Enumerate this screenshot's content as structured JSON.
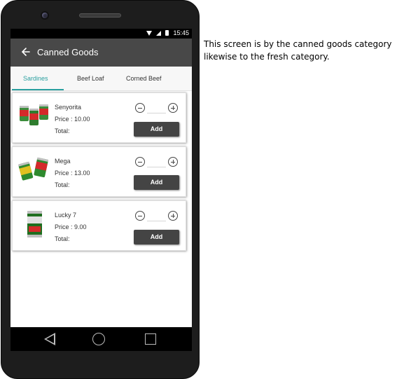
{
  "status_bar": {
    "time": "15:45"
  },
  "app_bar": {
    "title": "Canned Goods",
    "back_icon": "arrow-left-icon"
  },
  "tabs": [
    {
      "label": "Sardines",
      "active": true
    },
    {
      "label": "Beef Loaf",
      "active": false
    },
    {
      "label": "Corned Beef",
      "active": false
    }
  ],
  "products": [
    {
      "name": "Senyorita",
      "price": "Price : 10.00",
      "total": "Total:",
      "add_label": "Add"
    },
    {
      "name": "Mega",
      "price": "Price : 13.00",
      "total": "Total:",
      "add_label": "Add"
    },
    {
      "name": "Lucky 7",
      "price": "Price : 9.00",
      "total": "Total:",
      "add_label": "Add"
    }
  ],
  "annotation": {
    "line1": "This screen is by the canned goods category",
    "line2": "likewise to the fresh category."
  },
  "colors": {
    "app_bar": "#484848",
    "accent": "#2a9f9f",
    "button": "#444444"
  }
}
